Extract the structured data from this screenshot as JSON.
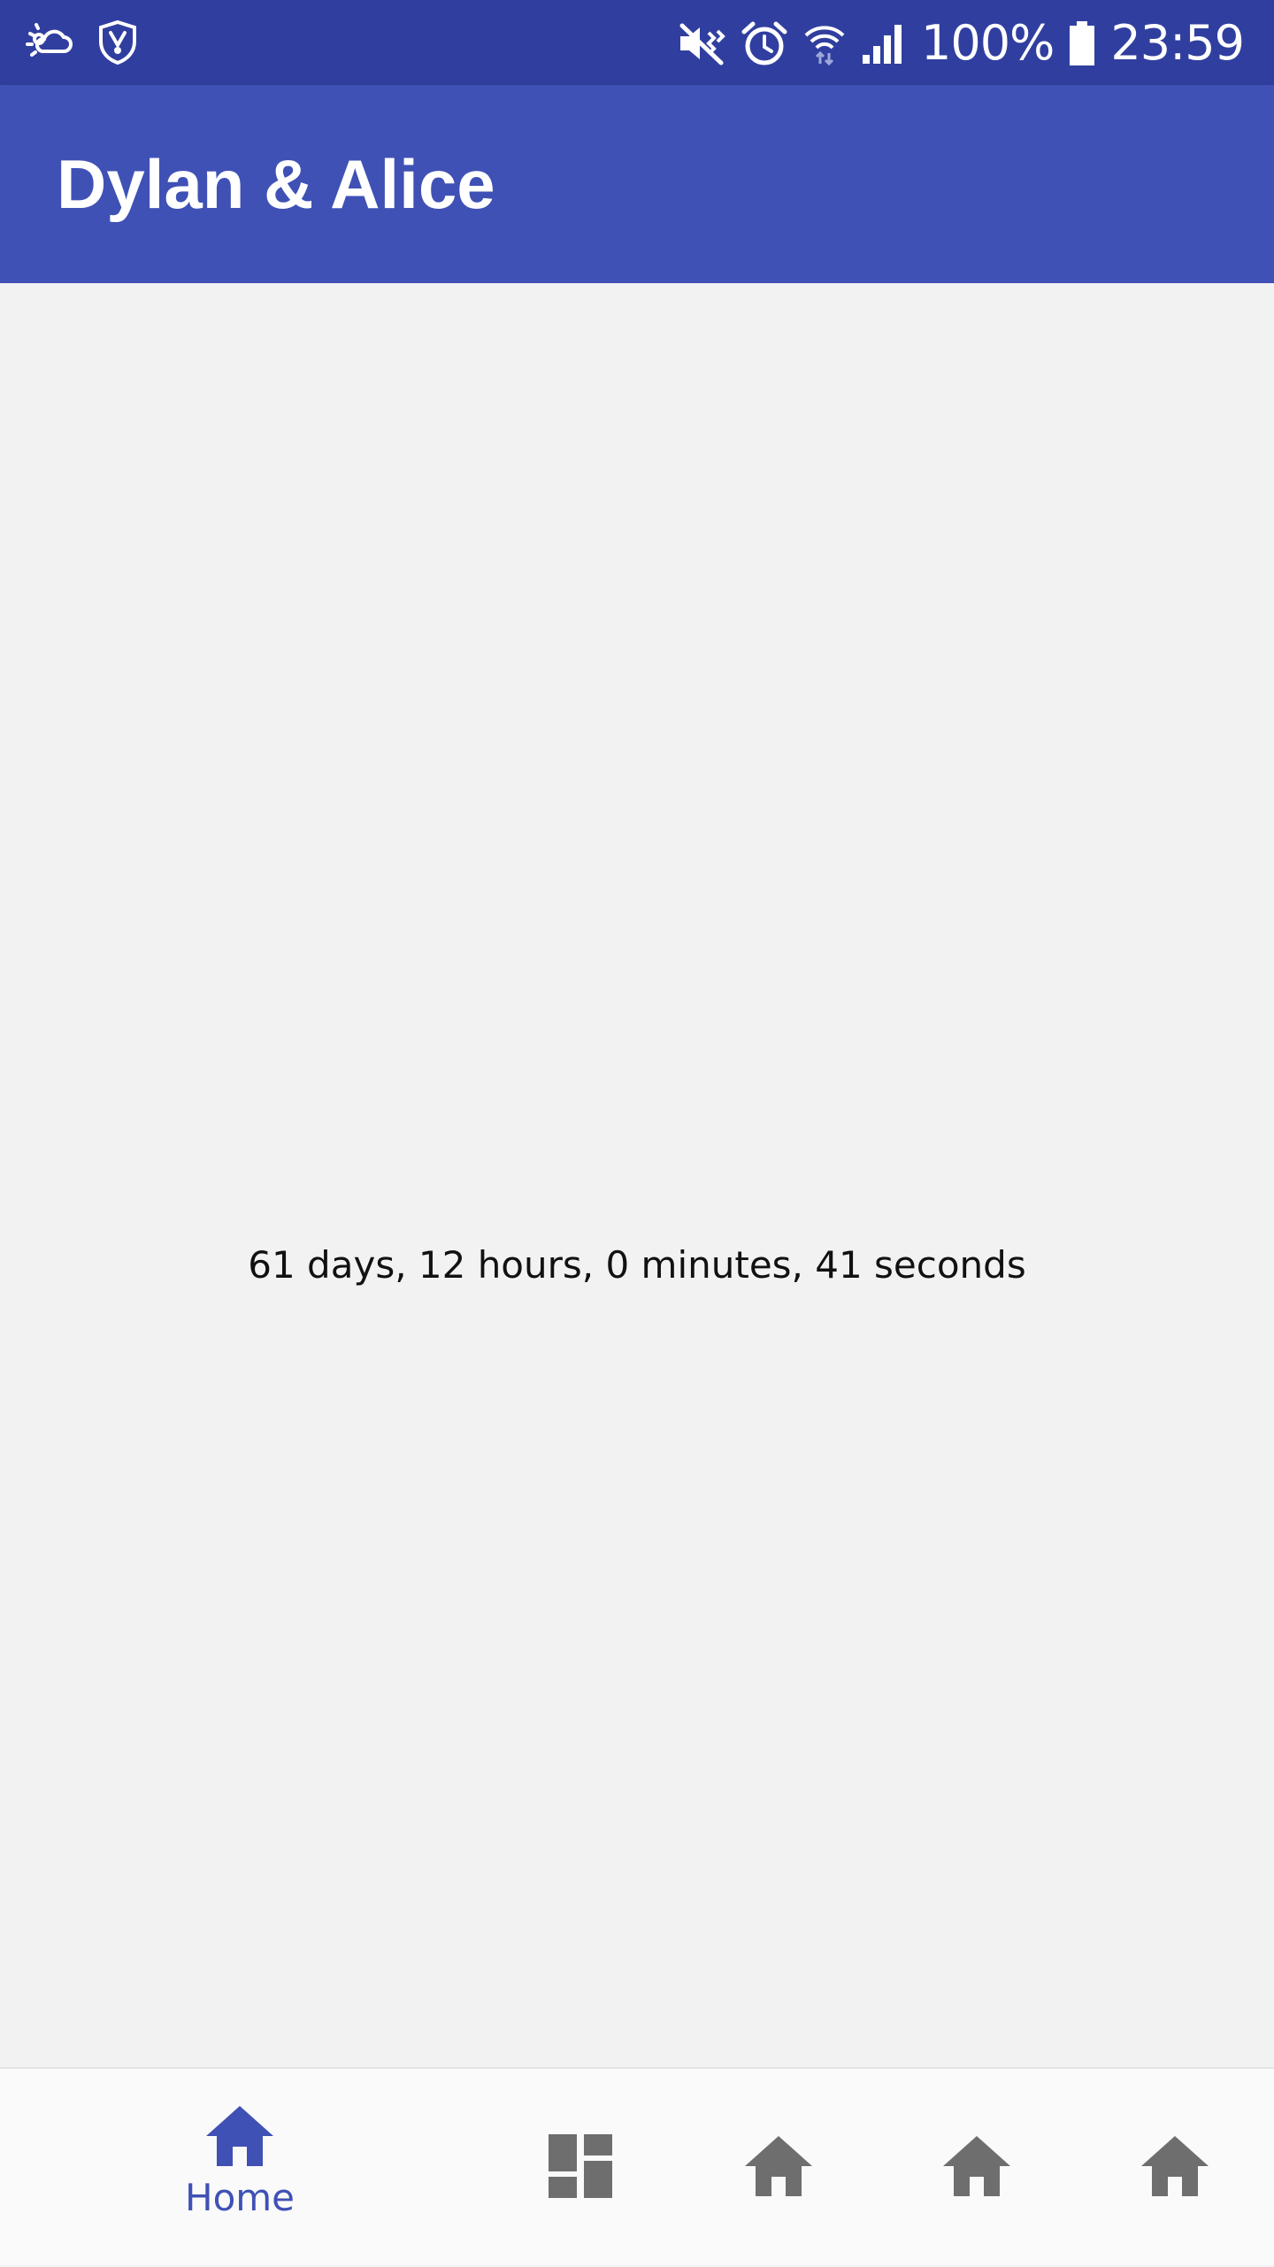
{
  "status_bar": {
    "battery_text": "100%",
    "time": "23:59",
    "left_icons": [
      "weather-icon",
      "shield-icon"
    ],
    "right_icons": [
      "vibrate-icon",
      "alarm-icon",
      "wifi-icon",
      "signal-icon",
      "battery-icon"
    ],
    "color": "#303f9f"
  },
  "app_bar": {
    "title": "Dylan & Alice",
    "color": "#3f51b5"
  },
  "content": {
    "counter_text": "61 days, 12 hours, 0 minutes, 41 seconds"
  },
  "bottom_nav": {
    "items": [
      {
        "label": "Home",
        "icon": "home-icon",
        "active": true
      },
      {
        "label": "",
        "icon": "dashboard-icon",
        "active": false
      },
      {
        "label": "",
        "icon": "home-icon",
        "active": false
      },
      {
        "label": "",
        "icon": "home-icon",
        "active": false
      },
      {
        "label": "",
        "icon": "home-icon",
        "active": false
      }
    ],
    "active_color": "#3f51b5",
    "inactive_color": "#6e6e6e"
  }
}
